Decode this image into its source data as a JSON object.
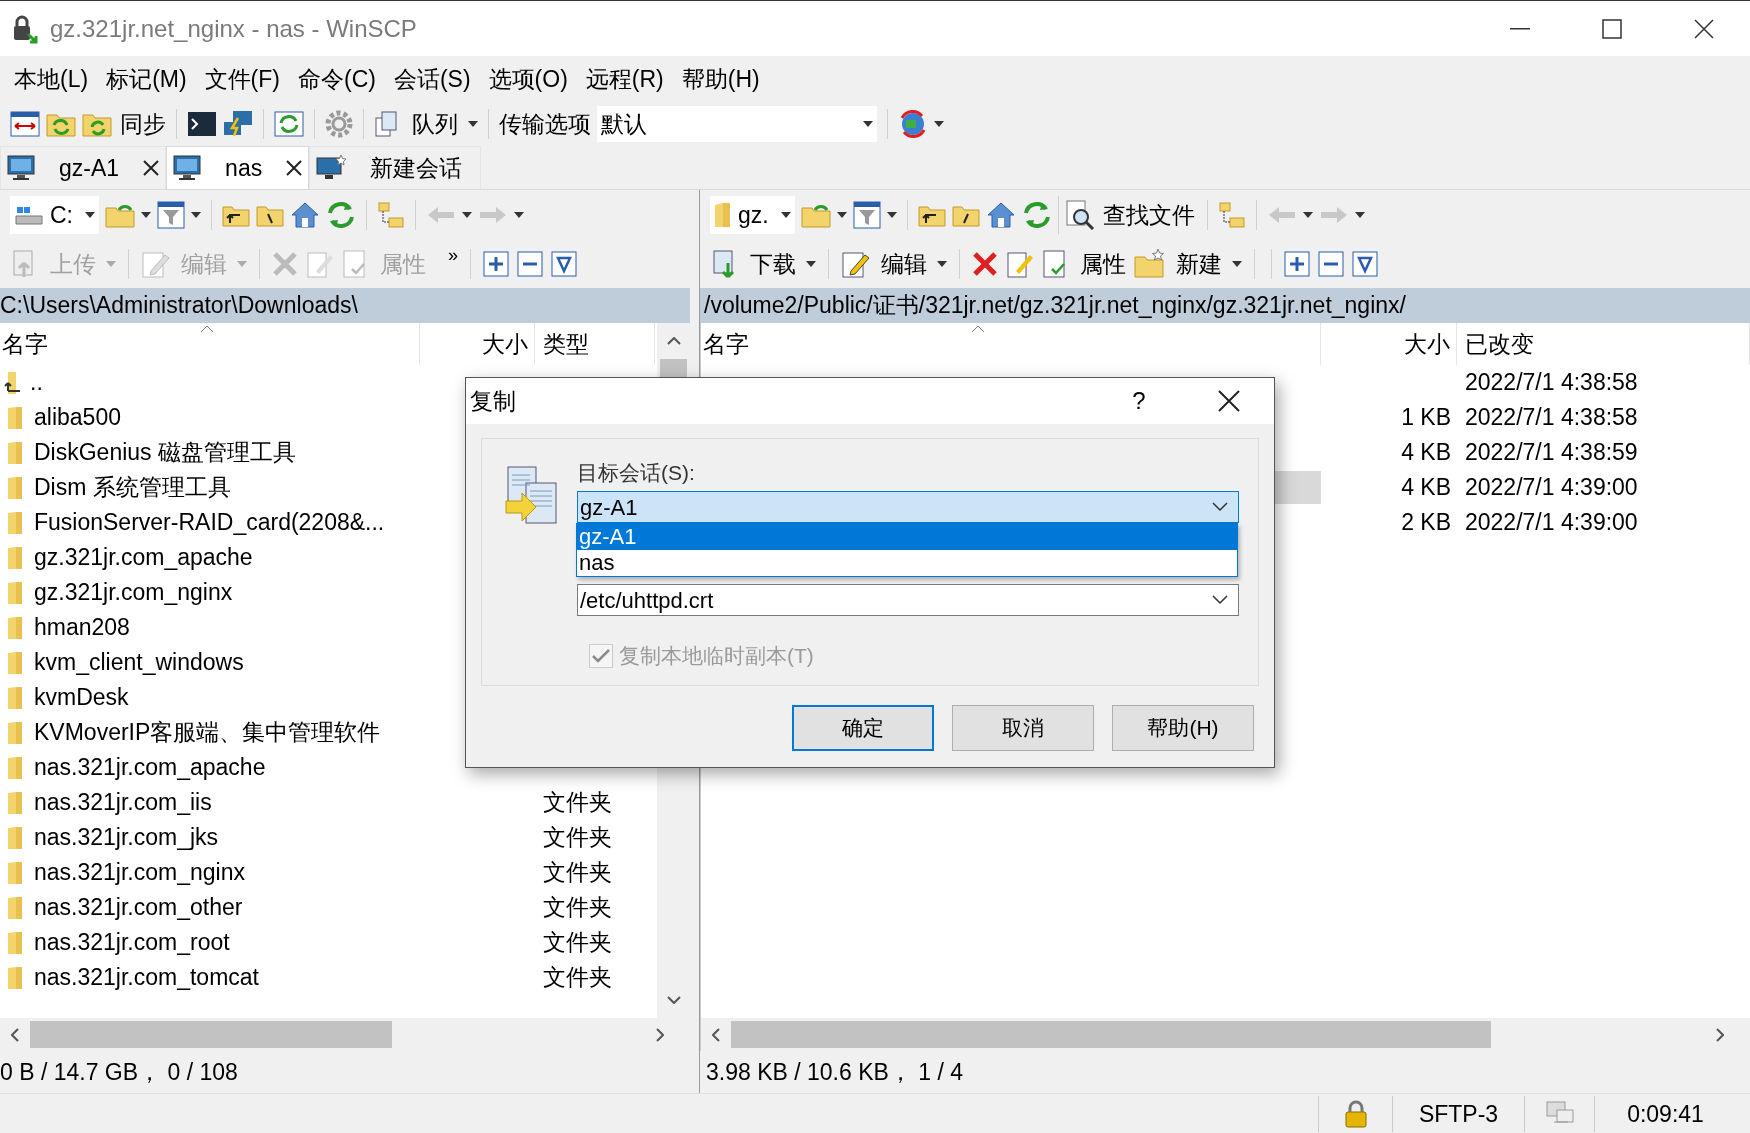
{
  "window": {
    "title": "gz.321jr.net_nginx - nas - WinSCP"
  },
  "menu": [
    "本地(L)",
    "标记(M)",
    "文件(F)",
    "命令(C)",
    "会话(S)",
    "选项(O)",
    "远程(R)",
    "帮助(H)"
  ],
  "toolbar": {
    "sync": "同步",
    "queue": "队列",
    "transfer_label": "传输选项",
    "transfer_value": "默认"
  },
  "session_tabs": [
    {
      "label": "gz-A1",
      "kind": "session",
      "selected": false
    },
    {
      "label": "nas",
      "kind": "session",
      "selected": true
    },
    {
      "label": "新建会话",
      "kind": "new",
      "selected": false
    }
  ],
  "left_pane": {
    "drive": "C:",
    "overflow": "»",
    "actions": [
      {
        "label": "上传",
        "kind": "upload",
        "disabled": true
      },
      {
        "label": "编辑",
        "kind": "edit",
        "disabled": true
      },
      {
        "label": "属性",
        "kind": "properties",
        "disabled": true
      }
    ],
    "path": "C:\\Users\\Administrator\\Downloads\\",
    "columns": [
      "名字",
      "大小",
      "类型"
    ],
    "rows": [
      {
        "name": "..",
        "kind": "parent"
      },
      {
        "name": "aliba500",
        "kind": "folder"
      },
      {
        "name": "DiskGenius 磁盘管理工具",
        "kind": "folder"
      },
      {
        "name": "Dism 系统管理工具",
        "kind": "folder"
      },
      {
        "name": "FusionServer-RAID_card(2208&...",
        "kind": "folder"
      },
      {
        "name": "gz.321jr.com_apache",
        "kind": "folder"
      },
      {
        "name": "gz.321jr.com_nginx",
        "kind": "folder"
      },
      {
        "name": "hman208",
        "kind": "folder"
      },
      {
        "name": "kvm_client_windows",
        "kind": "folder"
      },
      {
        "name": "kvmDesk",
        "kind": "folder"
      },
      {
        "name": "KVMoverIP客服端、集中管理软件",
        "kind": "folder"
      },
      {
        "name": "nas.321jr.com_apache",
        "kind": "folder"
      },
      {
        "name": "nas.321jr.com_iis",
        "kind": "folder",
        "type": "文件夹"
      },
      {
        "name": "nas.321jr.com_jks",
        "kind": "folder",
        "type": "文件夹"
      },
      {
        "name": "nas.321jr.com_nginx",
        "kind": "folder",
        "type": "文件夹"
      },
      {
        "name": "nas.321jr.com_other",
        "kind": "folder",
        "type": "文件夹"
      },
      {
        "name": "nas.321jr.com_root",
        "kind": "folder",
        "type": "文件夹"
      },
      {
        "name": "nas.321jr.com_tomcat",
        "kind": "folder",
        "type": "文件夹"
      }
    ],
    "status": "0 B / 14.7 GB， 0 / 108"
  },
  "right_pane": {
    "drive": "gz.",
    "find": "查找文件",
    "actions": [
      {
        "label": "下载",
        "kind": "download",
        "disabled": false
      },
      {
        "label": "编辑",
        "kind": "edit",
        "disabled": false
      },
      {
        "label": "属性",
        "kind": "properties",
        "disabled": false
      },
      {
        "label": "新建",
        "kind": "new",
        "disabled": false
      }
    ],
    "path": "/volume2/Public/证书/321jr.net/gz.321jr.net_nginx/gz.321jr.net_nginx/",
    "columns": [
      "名字",
      "大小",
      "已改变"
    ],
    "rows": [
      {
        "changed": "2022/7/1 4:38:58",
        "selected": false
      },
      {
        "size": "1 KB",
        "changed": "2022/7/1 4:38:58",
        "selected": false
      },
      {
        "size": "4 KB",
        "changed": "2022/7/1 4:38:59",
        "selected": false
      },
      {
        "size": "4 KB",
        "changed": "2022/7/1 4:39:00",
        "selected": true
      },
      {
        "size": "2 KB",
        "changed": "2022/7/1 4:39:00",
        "selected": false
      }
    ],
    "status": "3.98 KB / 10.6 KB， 1 / 4"
  },
  "status_bar": {
    "protocol": "SFTP-3",
    "elapsed": "0:09:41"
  },
  "dialog": {
    "title": "复制",
    "help": "?",
    "session_label": "目标会话(S):",
    "session_value": "gz-A1",
    "options": [
      {
        "label": "gz-A1",
        "selected": true
      },
      {
        "label": "nas",
        "selected": false
      }
    ],
    "path_value": "/etc/uhttpd.crt",
    "checkbox": {
      "label": "复制本地临时副本(T)",
      "checked": true,
      "disabled": true
    },
    "buttons": [
      {
        "label": "确定",
        "default": true
      },
      {
        "label": "取消",
        "default": false
      },
      {
        "label": "帮助(H)",
        "default": false
      }
    ]
  }
}
